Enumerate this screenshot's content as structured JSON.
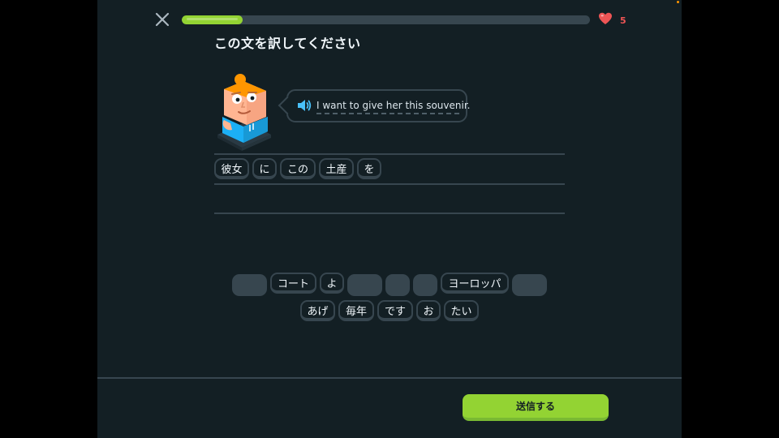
{
  "colors": {
    "background": "#131f24",
    "border": "#37464f",
    "accent_green": "#93d333",
    "heart_red": "#ee5555",
    "speaker_blue": "#49c0f8"
  },
  "header": {
    "close_icon": "close-x-icon",
    "progress": 0.15,
    "hearts_icon": "heart-icon",
    "hearts_count": "5"
  },
  "prompt": {
    "title": "この文を訳してください",
    "speaker_icon": "speaker-icon",
    "sentence": "I want to give her this souvenir."
  },
  "answer_tiles": [
    "彼女",
    "に",
    "この",
    "土産",
    "を"
  ],
  "word_bank": {
    "row1": [
      "",
      "コート",
      "よ",
      "",
      "",
      "",
      "ヨーロッパ",
      ""
    ],
    "row2": [
      "あげ",
      "毎年",
      "です",
      "お",
      "たい"
    ]
  },
  "footer": {
    "submit_label": "送信する"
  }
}
